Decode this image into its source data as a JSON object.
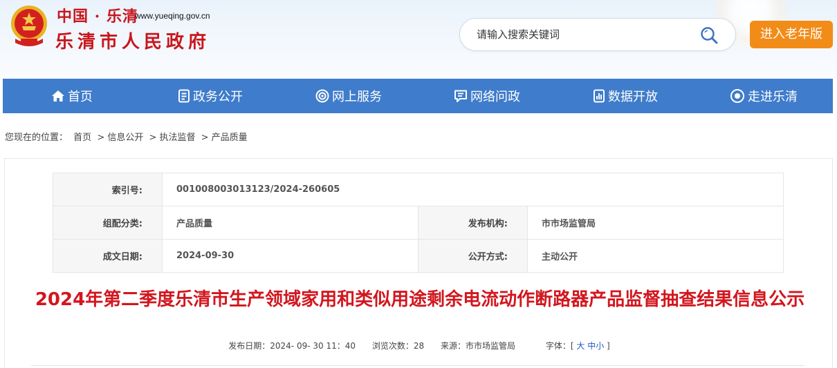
{
  "header": {
    "site_cn": "中国 · 乐清",
    "site_url": "www.yueqing.gov.cn",
    "site_name": "乐清市人民政府",
    "search_placeholder": "请输入搜索关键词",
    "elder_button": "进入老年版"
  },
  "nav": [
    {
      "label": "首页",
      "icon": "home-icon"
    },
    {
      "label": "政务公开",
      "icon": "document-icon"
    },
    {
      "label": "网上服务",
      "icon": "service-icon"
    },
    {
      "label": "网络问政",
      "icon": "chat-icon"
    },
    {
      "label": "数据开放",
      "icon": "data-icon"
    },
    {
      "label": "走进乐清",
      "icon": "eye-icon"
    }
  ],
  "breadcrumb": {
    "prefix": "您现在的位置：",
    "items": [
      "首页",
      "> 信息公开",
      "> 执法监督",
      "> 产品质量"
    ]
  },
  "meta": {
    "index_label": "索引号:",
    "index_value": "001008003013123/2024-260605",
    "category_label": "组配分类:",
    "category_value": "产品质量",
    "publisher_label": "发布机构:",
    "publisher_value": "市市场监管局",
    "date_label": "成文日期:",
    "date_value": "2024-09-30",
    "mode_label": "公开方式:",
    "mode_value": "主动公开"
  },
  "article": {
    "title": "2024年第二季度乐清市生产领域家用和类似用途剩余电流动作断路器产品监督抽查结果信息公示",
    "publish_label": "发布日期：",
    "publish_value": "2024- 09- 30 11：40",
    "views_label": "浏览次数：",
    "views_value": "28",
    "source_label": "来源：",
    "source_value": "市市场监管局",
    "font_label": "字体：",
    "font_open": "[",
    "font_large": "大",
    "font_medium": "中",
    "font_small": "小",
    "font_close": "]"
  },
  "colors": {
    "brand_red": "#c8161d",
    "nav_blue": "#3f7ccb",
    "elder_orange": "#f28c18"
  }
}
